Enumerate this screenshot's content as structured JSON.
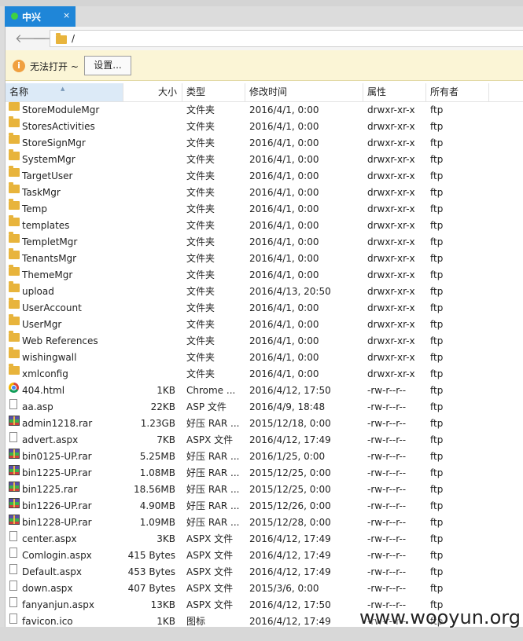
{
  "tab": {
    "title": "中兴",
    "close": "×"
  },
  "address": {
    "path": "/"
  },
  "infobar": {
    "message": "无法打开 ~",
    "button_label": "设置...",
    "icon": "i"
  },
  "columns": [
    "名称",
    "大小",
    "类型",
    "修改时间",
    "属性",
    "所有者"
  ],
  "rows": [
    {
      "icon": "folder",
      "name": "StoreModuleMgr",
      "size": "",
      "type": "文件夹",
      "modified": "2016/4/1, 0:00",
      "attr": "drwxr-xr-x",
      "owner": "ftp"
    },
    {
      "icon": "folder",
      "name": "StoresActivities",
      "size": "",
      "type": "文件夹",
      "modified": "2016/4/1, 0:00",
      "attr": "drwxr-xr-x",
      "owner": "ftp"
    },
    {
      "icon": "folder",
      "name": "StoreSignMgr",
      "size": "",
      "type": "文件夹",
      "modified": "2016/4/1, 0:00",
      "attr": "drwxr-xr-x",
      "owner": "ftp"
    },
    {
      "icon": "folder",
      "name": "SystemMgr",
      "size": "",
      "type": "文件夹",
      "modified": "2016/4/1, 0:00",
      "attr": "drwxr-xr-x",
      "owner": "ftp"
    },
    {
      "icon": "folder",
      "name": "TargetUser",
      "size": "",
      "type": "文件夹",
      "modified": "2016/4/1, 0:00",
      "attr": "drwxr-xr-x",
      "owner": "ftp"
    },
    {
      "icon": "folder",
      "name": "TaskMgr",
      "size": "",
      "type": "文件夹",
      "modified": "2016/4/1, 0:00",
      "attr": "drwxr-xr-x",
      "owner": "ftp"
    },
    {
      "icon": "folder",
      "name": "Temp",
      "size": "",
      "type": "文件夹",
      "modified": "2016/4/1, 0:00",
      "attr": "drwxr-xr-x",
      "owner": "ftp"
    },
    {
      "icon": "folder",
      "name": "templates",
      "size": "",
      "type": "文件夹",
      "modified": "2016/4/1, 0:00",
      "attr": "drwxr-xr-x",
      "owner": "ftp"
    },
    {
      "icon": "folder",
      "name": "TempletMgr",
      "size": "",
      "type": "文件夹",
      "modified": "2016/4/1, 0:00",
      "attr": "drwxr-xr-x",
      "owner": "ftp"
    },
    {
      "icon": "folder",
      "name": "TenantsMgr",
      "size": "",
      "type": "文件夹",
      "modified": "2016/4/1, 0:00",
      "attr": "drwxr-xr-x",
      "owner": "ftp"
    },
    {
      "icon": "folder",
      "name": "ThemeMgr",
      "size": "",
      "type": "文件夹",
      "modified": "2016/4/1, 0:00",
      "attr": "drwxr-xr-x",
      "owner": "ftp"
    },
    {
      "icon": "folder",
      "name": "upload",
      "size": "",
      "type": "文件夹",
      "modified": "2016/4/13, 20:50",
      "attr": "drwxr-xr-x",
      "owner": "ftp"
    },
    {
      "icon": "folder",
      "name": "UserAccount",
      "size": "",
      "type": "文件夹",
      "modified": "2016/4/1, 0:00",
      "attr": "drwxr-xr-x",
      "owner": "ftp"
    },
    {
      "icon": "folder",
      "name": "UserMgr",
      "size": "",
      "type": "文件夹",
      "modified": "2016/4/1, 0:00",
      "attr": "drwxr-xr-x",
      "owner": "ftp"
    },
    {
      "icon": "folder",
      "name": "Web References",
      "size": "",
      "type": "文件夹",
      "modified": "2016/4/1, 0:00",
      "attr": "drwxr-xr-x",
      "owner": "ftp"
    },
    {
      "icon": "folder",
      "name": "wishingwall",
      "size": "",
      "type": "文件夹",
      "modified": "2016/4/1, 0:00",
      "attr": "drwxr-xr-x",
      "owner": "ftp"
    },
    {
      "icon": "folder",
      "name": "xmlconfig",
      "size": "",
      "type": "文件夹",
      "modified": "2016/4/1, 0:00",
      "attr": "drwxr-xr-x",
      "owner": "ftp"
    },
    {
      "icon": "chrome",
      "name": "404.html",
      "size": "1KB",
      "type": "Chrome ...",
      "modified": "2016/4/12, 17:50",
      "attr": "-rw-r--r--",
      "owner": "ftp"
    },
    {
      "icon": "file",
      "name": "aa.asp",
      "size": "22KB",
      "type": "ASP 文件",
      "modified": "2016/4/9, 18:48",
      "attr": "-rw-r--r--",
      "owner": "ftp"
    },
    {
      "icon": "rar",
      "name": "admin1218.rar",
      "size": "1.23GB",
      "type": "好压 RAR ...",
      "modified": "2015/12/18, 0:00",
      "attr": "-rw-r--r--",
      "owner": "ftp"
    },
    {
      "icon": "file",
      "name": "advert.aspx",
      "size": "7KB",
      "type": "ASPX 文件",
      "modified": "2016/4/12, 17:49",
      "attr": "-rw-r--r--",
      "owner": "ftp"
    },
    {
      "icon": "rar",
      "name": "bin0125-UP.rar",
      "size": "5.25MB",
      "type": "好压 RAR ...",
      "modified": "2016/1/25, 0:00",
      "attr": "-rw-r--r--",
      "owner": "ftp"
    },
    {
      "icon": "rar",
      "name": "bin1225-UP.rar",
      "size": "1.08MB",
      "type": "好压 RAR ...",
      "modified": "2015/12/25, 0:00",
      "attr": "-rw-r--r--",
      "owner": "ftp"
    },
    {
      "icon": "rar",
      "name": "bin1225.rar",
      "size": "18.56MB",
      "type": "好压 RAR ...",
      "modified": "2015/12/25, 0:00",
      "attr": "-rw-r--r--",
      "owner": "ftp"
    },
    {
      "icon": "rar",
      "name": "bin1226-UP.rar",
      "size": "4.90MB",
      "type": "好压 RAR ...",
      "modified": "2015/12/26, 0:00",
      "attr": "-rw-r--r--",
      "owner": "ftp"
    },
    {
      "icon": "rar",
      "name": "bin1228-UP.rar",
      "size": "1.09MB",
      "type": "好压 RAR ...",
      "modified": "2015/12/28, 0:00",
      "attr": "-rw-r--r--",
      "owner": "ftp"
    },
    {
      "icon": "file",
      "name": "center.aspx",
      "size": "3KB",
      "type": "ASPX 文件",
      "modified": "2016/4/12, 17:49",
      "attr": "-rw-r--r--",
      "owner": "ftp"
    },
    {
      "icon": "file",
      "name": "Comlogin.aspx",
      "size": "415 Bytes",
      "type": "ASPX 文件",
      "modified": "2016/4/12, 17:49",
      "attr": "-rw-r--r--",
      "owner": "ftp"
    },
    {
      "icon": "file",
      "name": "Default.aspx",
      "size": "453 Bytes",
      "type": "ASPX 文件",
      "modified": "2016/4/12, 17:49",
      "attr": "-rw-r--r--",
      "owner": "ftp"
    },
    {
      "icon": "file",
      "name": "down.aspx",
      "size": "407 Bytes",
      "type": "ASPX 文件",
      "modified": "2015/3/6, 0:00",
      "attr": "-rw-r--r--",
      "owner": "ftp"
    },
    {
      "icon": "file",
      "name": "fanyanjun.aspx",
      "size": "13KB",
      "type": "ASPX 文件",
      "modified": "2016/4/12, 17:50",
      "attr": "-rw-r--r--",
      "owner": "ftp"
    },
    {
      "icon": "file",
      "name": "favicon.ico",
      "size": "1KB",
      "type": "图标",
      "modified": "2016/4/12, 17:49",
      "attr": "-rw-r--r--",
      "owner": "ftp"
    }
  ],
  "watermark": "www.wooyun.org"
}
